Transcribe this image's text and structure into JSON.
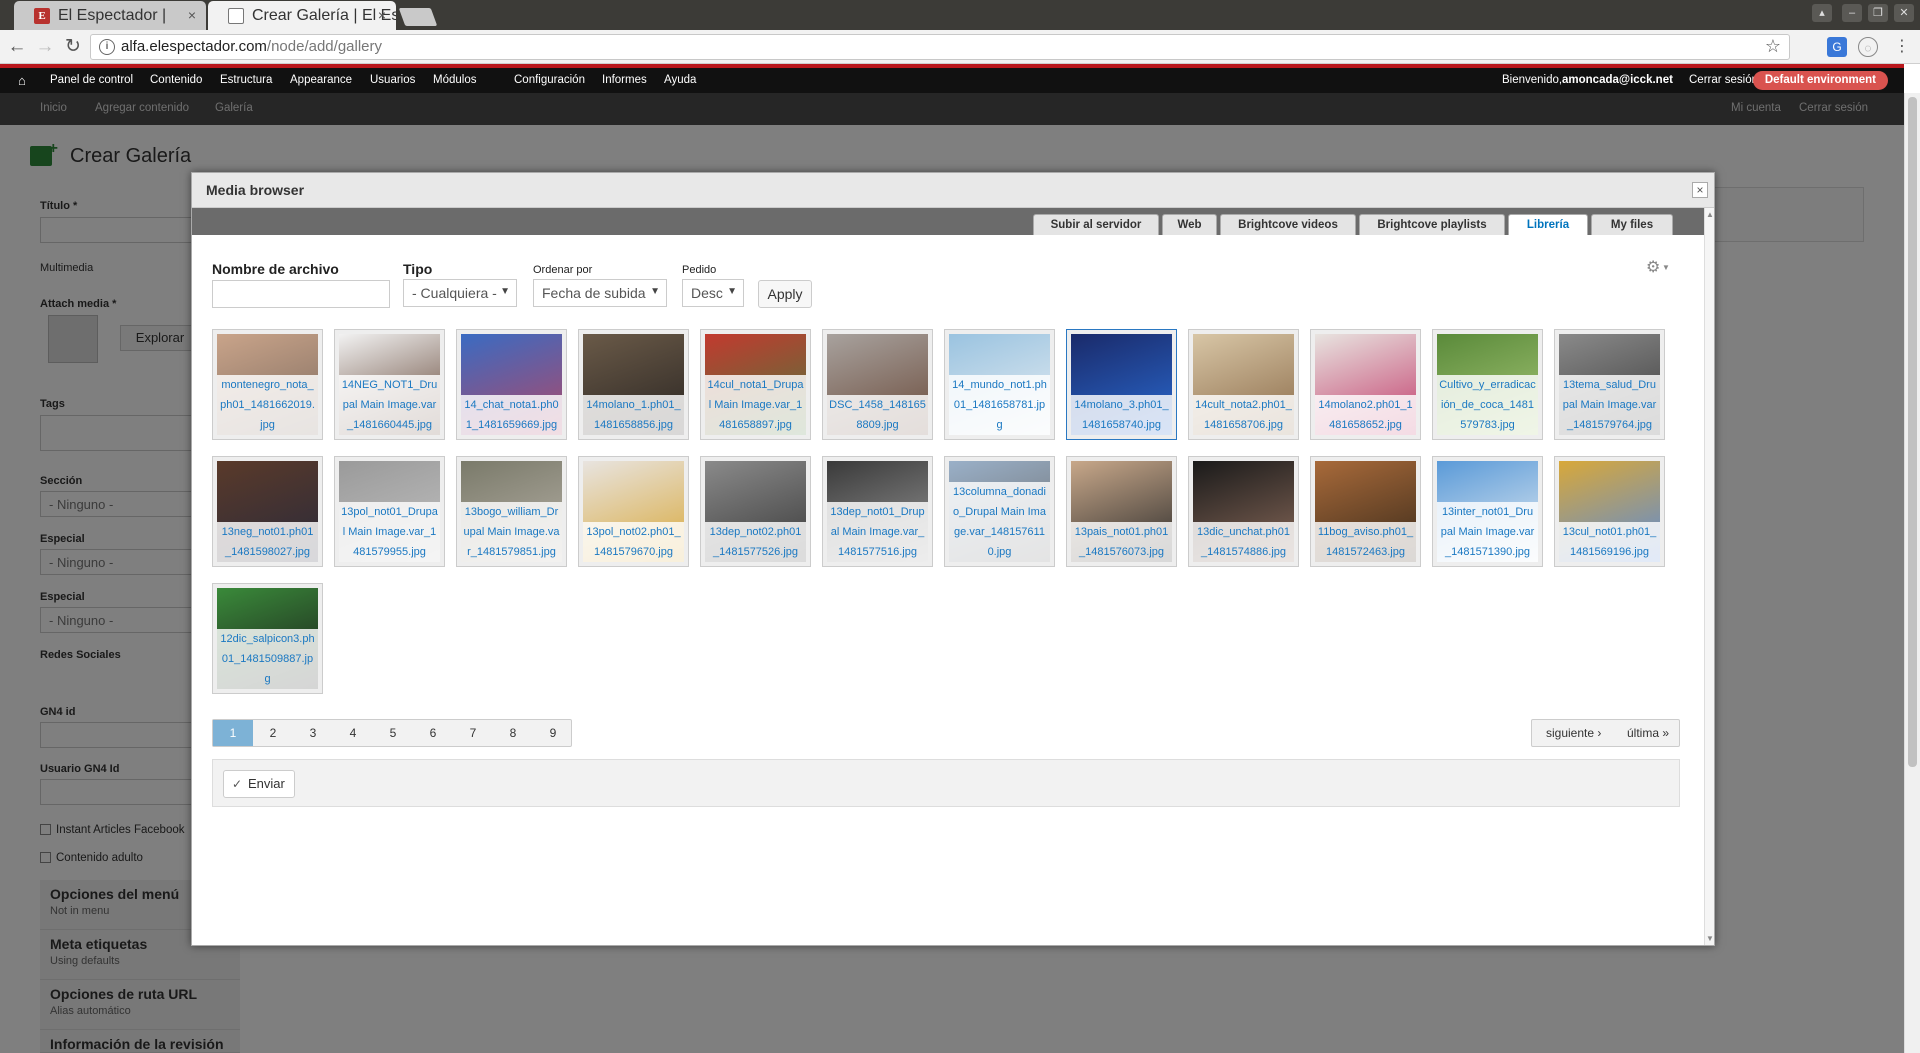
{
  "browser": {
    "tabs": [
      {
        "title": "El Espectador |",
        "close": "×"
      },
      {
        "title": "Crear Galería | El Es",
        "close": "×"
      }
    ],
    "window_controls": [
      "▴",
      "–",
      "❐",
      "✕"
    ],
    "url_host": "alfa.elespectador.com",
    "url_path": "/node/add/gallery"
  },
  "admin_toolbar": {
    "items": [
      "Panel de control",
      "Contenido",
      "Estructura",
      "Appearance",
      "Usuarios",
      "Módulos",
      "Configuración",
      "Informes",
      "Ayuda"
    ],
    "welcome": "Bienvenido,",
    "user": "amoncada@icck.net",
    "logout": "Cerrar sesión",
    "environment": "Default environment"
  },
  "shortcuts": {
    "left": [
      "Inicio",
      "Agregar contenido",
      "Galería"
    ],
    "right": [
      "Mi cuenta",
      "Cerrar sesión"
    ]
  },
  "page": {
    "title": "Crear Galería",
    "fields": {
      "titulo": "Título *",
      "multimedia": "Multimedia",
      "attach_media": "Attach media *",
      "explorar": "Explorar",
      "tags": "Tags",
      "seccion": "Sección",
      "ninguno": "- Ninguno -",
      "especial": "Especial",
      "redes_sociales": "Redes Sociales",
      "gn4_id": "GN4 id",
      "usuario_gn4_id": "Usuario GN4 Id",
      "instant_articles": "Instant Articles Facebook",
      "contenido_adulto": "Contenido adulto"
    },
    "vertical_tabs": [
      {
        "title": "Opciones del menú",
        "sub": "Not in menu"
      },
      {
        "title": "Meta etiquetas",
        "sub": "Using defaults"
      },
      {
        "title": "Opciones de ruta URL",
        "sub": "Alias automático"
      },
      {
        "title": "Información de la revisión",
        "sub": ""
      }
    ]
  },
  "media_browser": {
    "title": "Media browser",
    "close": "×",
    "tabs": [
      "Subir al servidor",
      "Web",
      "Brightcove videos",
      "Brightcove playlists",
      "Librería",
      "My files"
    ],
    "active_tab": "Librería",
    "filters": {
      "filename_label": "Nombre de archivo",
      "filename_value": "",
      "type_label": "Tipo",
      "type_value": "- Cualquiera -",
      "sort_label": "Ordenar por",
      "sort_value": "Fecha de subida",
      "order_label": "Pedido",
      "order_value": "Desc",
      "apply": "Apply"
    },
    "files": [
      {
        "name": "montenegro_nota_ph01_1481662019.jpg",
        "colors": [
          "#c9a48a",
          "#7d6a5e"
        ]
      },
      {
        "name": "14NEG_NOT1_Drupal Main Image.var_1481660445.jpg",
        "colors": [
          "#f2f2f2",
          "#5b3b2a"
        ]
      },
      {
        "name": "14_chat_nota1.ph01_1481659669.jpg",
        "colors": [
          "#3a6bc2",
          "#b04868"
        ]
      },
      {
        "name": "14molano_1.ph01_1481658856.jpg",
        "colors": [
          "#6a5a48",
          "#2a2522"
        ]
      },
      {
        "name": "14cul_nota1_Drupal Main Image.var_1481658897.jpg",
        "colors": [
          "#c23a2f",
          "#4a7a3c"
        ]
      },
      {
        "name": "DSC_1458_1481658809.jpg",
        "colors": [
          "#a8a29e",
          "#6a4a3a"
        ]
      },
      {
        "name": "14_mundo_not1.ph01_1481658781.jpg",
        "colors": [
          "#9ac3e0",
          "#e8eef2"
        ]
      },
      {
        "name": "14molano_3.ph01_1481658740.jpg",
        "colors": [
          "#1a2a6a",
          "#2a6ad0"
        ]
      },
      {
        "name": "14cult_nota2.ph01_1481658706.jpg",
        "colors": [
          "#d8c6a6",
          "#8a6a48"
        ]
      },
      {
        "name": "14molano2.ph01_1481658652.jpg",
        "colors": [
          "#e8e4e0",
          "#c23a6a"
        ]
      },
      {
        "name": "Cultivo_y_erradicación_de_coca_1481579783.jpg",
        "colors": [
          "#5a8a3a",
          "#a8c878"
        ]
      },
      {
        "name": "13tema_salud_Drupal Main Image.var_1481579764.jpg",
        "colors": [
          "#8a8a8a",
          "#3a3a3a"
        ]
      },
      {
        "name": "13neg_not01.ph01_1481598027.jpg",
        "colors": [
          "#5a3a2a",
          "#2a2a3a"
        ]
      },
      {
        "name": "13pol_not01_Drupal Main Image.var_1481579955.jpg",
        "colors": [
          "#9a9a9a",
          "#c2c2c2"
        ]
      },
      {
        "name": "13bogo_william_Drupal Main Image.var_1481579851.jpg",
        "colors": [
          "#7a7a6a",
          "#b8b2a8"
        ]
      },
      {
        "name": "13pol_not02.ph01_1481579670.jpg",
        "colors": [
          "#e8e4e0",
          "#d8a83a"
        ]
      },
      {
        "name": "13dep_not02.ph01_1481577526.jpg",
        "colors": [
          "#8a8a8a",
          "#3a3a3a"
        ]
      },
      {
        "name": "13dep_not01_Drupal Main Image.var_1481577516.jpg",
        "colors": [
          "#3a3a3a",
          "#9a9a9a"
        ]
      },
      {
        "name": "13columna_donadio_Drupal Main Image.var_1481576110.jpg",
        "colors": [
          "#9ab0c8",
          "#6a6a6a"
        ]
      },
      {
        "name": "13pais_not01.ph01_1481576073.jpg",
        "colors": [
          "#c8a88a",
          "#2a2a2a"
        ]
      },
      {
        "name": "13dic_unchat.ph01_1481574886.jpg",
        "colors": [
          "#1a1a1a",
          "#8a6a5a"
        ]
      },
      {
        "name": "11bog_aviso.ph01_1481572463.jpg",
        "colors": [
          "#a86a3a",
          "#3a2a1a"
        ]
      },
      {
        "name": "13inter_not01_Drupal Main Image.var_1481571390.jpg",
        "colors": [
          "#5a9ad8",
          "#e8eef2"
        ]
      },
      {
        "name": "13cul_not01.ph01_1481569196.jpg",
        "colors": [
          "#d8a83a",
          "#5a8ad8"
        ]
      },
      {
        "name": "12dic_salpicon3.ph01_1481509887.jpg",
        "colors": [
          "#3a8a3a",
          "#1a1a1a"
        ]
      }
    ],
    "selected_file": "14molano_3.ph01_1481658740.jpg",
    "pager": {
      "pages": [
        "1",
        "2",
        "3",
        "4",
        "5",
        "6",
        "7",
        "8",
        "9"
      ],
      "current": "1",
      "next": "siguiente ›",
      "last": "última »"
    },
    "submit": "Enviar"
  }
}
